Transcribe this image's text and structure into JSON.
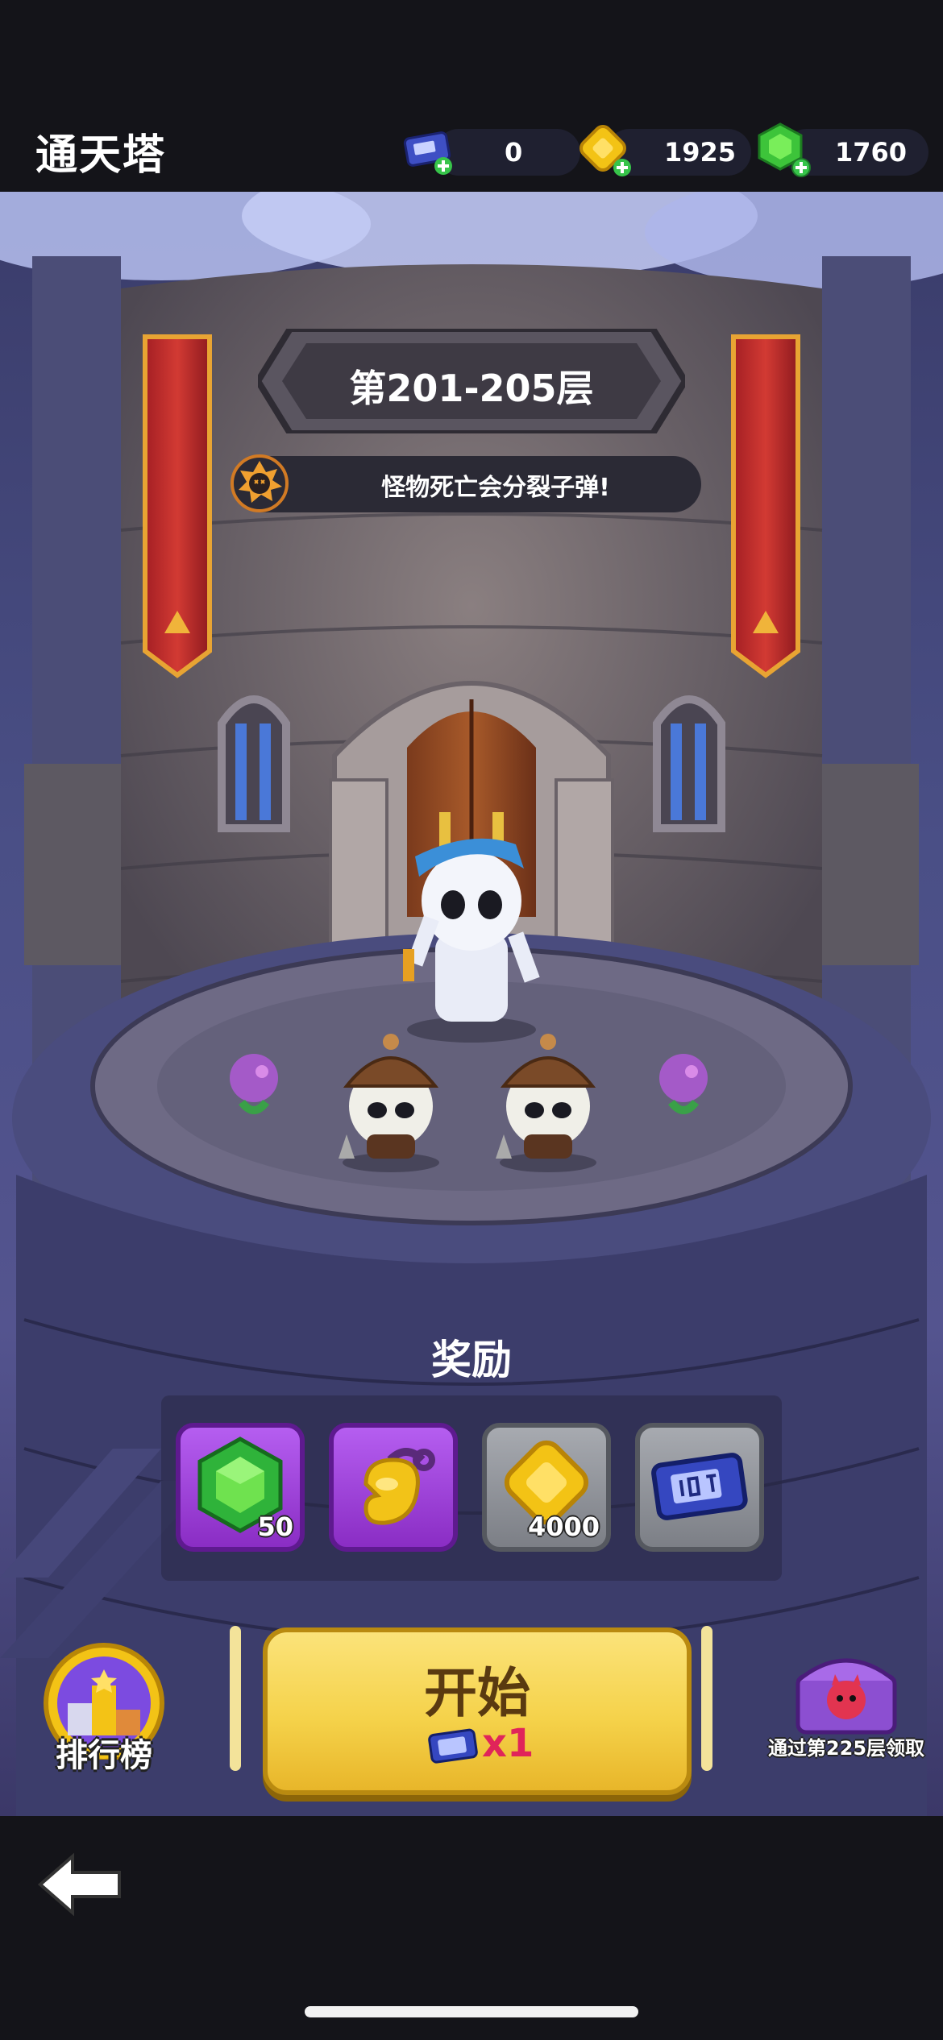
{
  "header": {
    "title": "通天塔",
    "resources": [
      {
        "name": "ticket",
        "value": "0"
      },
      {
        "name": "gold",
        "value": "1925"
      },
      {
        "name": "gem",
        "value": "1760"
      }
    ]
  },
  "stage": {
    "floor_range": "第201-205层",
    "modifier_text": "怪物死亡会分裂子弹!"
  },
  "rewards": {
    "title": "奖励",
    "items": [
      {
        "icon": "emerald-gem-icon",
        "count": "50"
      },
      {
        "icon": "golden-key-icon",
        "count": ""
      },
      {
        "icon": "gold-coin-icon",
        "count": "4000"
      },
      {
        "icon": "ticket-icon",
        "count": ""
      }
    ]
  },
  "actions": {
    "leaderboard_label": "排行榜",
    "start_label": "开始",
    "start_cost": "x1",
    "chest_label": "通过第225层领取"
  },
  "colors": {
    "gold_button": "#f5d24a",
    "purple_reward": "#9a3bd6",
    "grey_reward": "#8a8d93"
  }
}
